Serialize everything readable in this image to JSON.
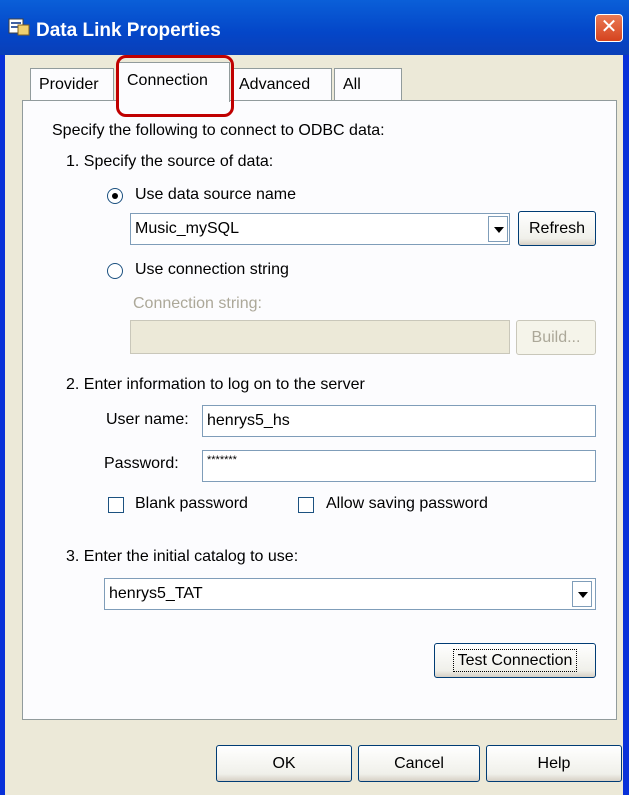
{
  "window": {
    "title": "Data Link Properties",
    "icon": "data-link-icon",
    "close_icon": "close-icon"
  },
  "tabs": [
    {
      "label": "Provider"
    },
    {
      "label": "Connection"
    },
    {
      "label": "Advanced"
    },
    {
      "label": "All"
    }
  ],
  "connection": {
    "intro": "Specify the following to connect to ODBC data:",
    "step1": "1. Specify the source of data:",
    "use_dsn": "Use data source name",
    "dsn_value": "Music_mySQL",
    "refresh": "Refresh",
    "use_conn_string": "Use connection string",
    "conn_string_label": "Connection string:",
    "conn_string_value": "",
    "build": "Build...",
    "step2": "2. Enter information to log on to the server",
    "user_name_label": "User name:",
    "user_name_value": "henrys5_hs",
    "password_label": "Password:",
    "password_value": "*******",
    "blank_password": "Blank password",
    "allow_saving": "Allow saving password",
    "step3": "3. Enter the initial catalog to use:",
    "catalog_value": "henrys5_TAT",
    "test_connection": "Test Connection"
  },
  "footer": {
    "ok": "OK",
    "cancel": "Cancel",
    "help": "Help"
  },
  "colors": {
    "title_bar": "#0446c8",
    "dialog_bg": "#ece9d8",
    "highlight_box": "#c00000"
  }
}
